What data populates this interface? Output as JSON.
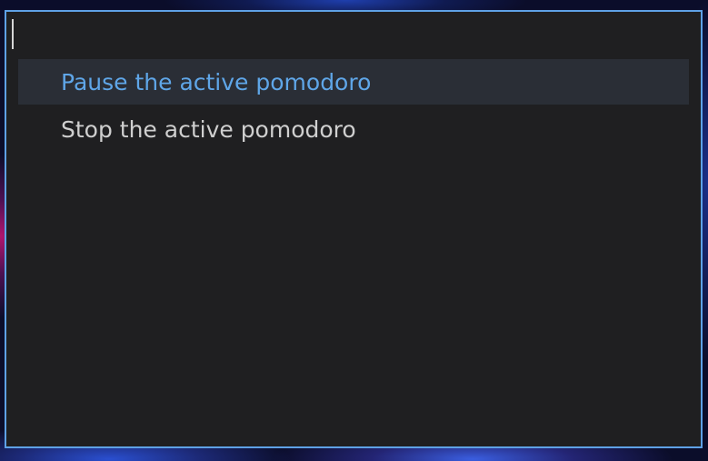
{
  "launcher": {
    "query": {
      "value": "",
      "placeholder": ""
    },
    "results": [
      {
        "label": "Pause the active pomodoro",
        "selected": true
      },
      {
        "label": "Stop the active pomodoro",
        "selected": false
      }
    ]
  },
  "colors": {
    "border": "#5ea1e6",
    "panel_bg": "#1f1f21",
    "selected_bg": "#2a2e36",
    "selected_text": "#5fa6e8",
    "text": "#cfcfcf"
  }
}
